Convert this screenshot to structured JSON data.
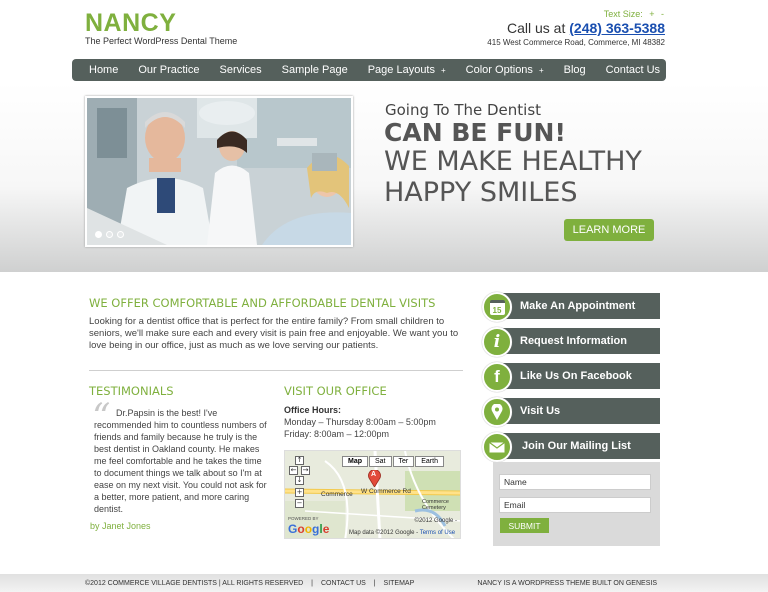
{
  "header": {
    "logo": "NANCY",
    "tagline": "The Perfect WordPress Dental Theme",
    "text_size_label": "Text Size:",
    "text_size_increase": "+",
    "text_size_decrease": "-",
    "call_label": "Call us at ",
    "phone": "(248) 363-5388",
    "address": "415 West Commerce Road, Commerce, MI 48382"
  },
  "nav": {
    "items": [
      {
        "label": "Home"
      },
      {
        "label": "Our Practice"
      },
      {
        "label": "Services"
      },
      {
        "label": "Sample Page"
      },
      {
        "label": "Page Layouts",
        "caret": "+"
      },
      {
        "label": "Color Options",
        "caret": "+"
      },
      {
        "label": "Blog"
      },
      {
        "label": "Contact Us"
      }
    ]
  },
  "hero": {
    "line1": "Going To The Dentist",
    "line2": "CAN BE FUN!",
    "line3": "WE MAKE HEALTHY",
    "line4": "HAPPY SMILES",
    "button": "LEARN MORE"
  },
  "intro": {
    "title": "WE OFFER COMFORTABLE AND AFFORDABLE DENTAL VISITS",
    "text": "Looking for a dentist office that is perfect for the entire family? From small children to seniors, we'll make sure each and every visit is pain free and enjoyable. We want you to love being in our office, just as much as we love serving our patients."
  },
  "testimonials": {
    "title": "TESTIMONIALS",
    "quote_mark": "“",
    "text": "Dr.Papsin is the best! I've recommended him to countless numbers of friends and family because he truly is the best dentist in Oakland county. He makes me feel comfortable and he takes the time to document things we talk about so I'm at ease on my next visit. You could not ask for a better, more patient, and more caring dentist.",
    "by": "by Janet Jones"
  },
  "visit": {
    "title": "VISIT OUR OFFICE",
    "hours_label": "Office Hours:",
    "hours_1": "Monday – Thursday 8:00am – 5:00pm",
    "hours_2": "Friday: 8:00am – 12:00pm",
    "map": {
      "types": [
        "Map",
        "Sat",
        "Ter",
        "Earth"
      ],
      "road_label": "Commerce",
      "road_label_2": "W Commerce Rd",
      "marker": "A",
      "cemetery": "Commerce Cemetery",
      "copy_right": "©2012 Google -",
      "copy_bottom": "Map data ©2012 Google - ",
      "terms": "Terms of Use",
      "powered": "POWERED BY",
      "google": "Google",
      "ctrl_up": "↑",
      "ctrl_left": "←",
      "ctrl_right": "→",
      "ctrl_down": "↓",
      "ctrl_zoom_in": "+",
      "ctrl_zoom_out": "−"
    }
  },
  "sidebar": {
    "items": [
      {
        "label": "Make An Appointment",
        "icon": "calendar-icon",
        "glyph": "15"
      },
      {
        "label": "Request Information",
        "icon": "info-icon",
        "glyph": "i"
      },
      {
        "label": "Like Us On Facebook",
        "icon": "facebook-icon",
        "glyph": "f"
      },
      {
        "label": "Visit Us",
        "icon": "location-pin-icon",
        "glyph": "⚑"
      },
      {
        "label": "Join Our Mailing List",
        "icon": "mail-icon",
        "glyph": "✉"
      }
    ],
    "mailing": {
      "name_placeholder": "Name",
      "email_placeholder": "Email",
      "submit": "SUBMIT"
    }
  },
  "footer": {
    "copyright": "©2012 COMMERCE VILLAGE DENTISTS | ALL RIGHTS RESERVED",
    "sep": "|",
    "contact": "CONTACT US",
    "sitemap": "SITEMAP",
    "right": "NANCY IS A WORDPRESS THEME BUILT ON GENESIS"
  },
  "colors": {
    "accent_green": "#7fb03e",
    "nav_gray": "#55605c",
    "phone_blue": "#1a4fb0"
  }
}
